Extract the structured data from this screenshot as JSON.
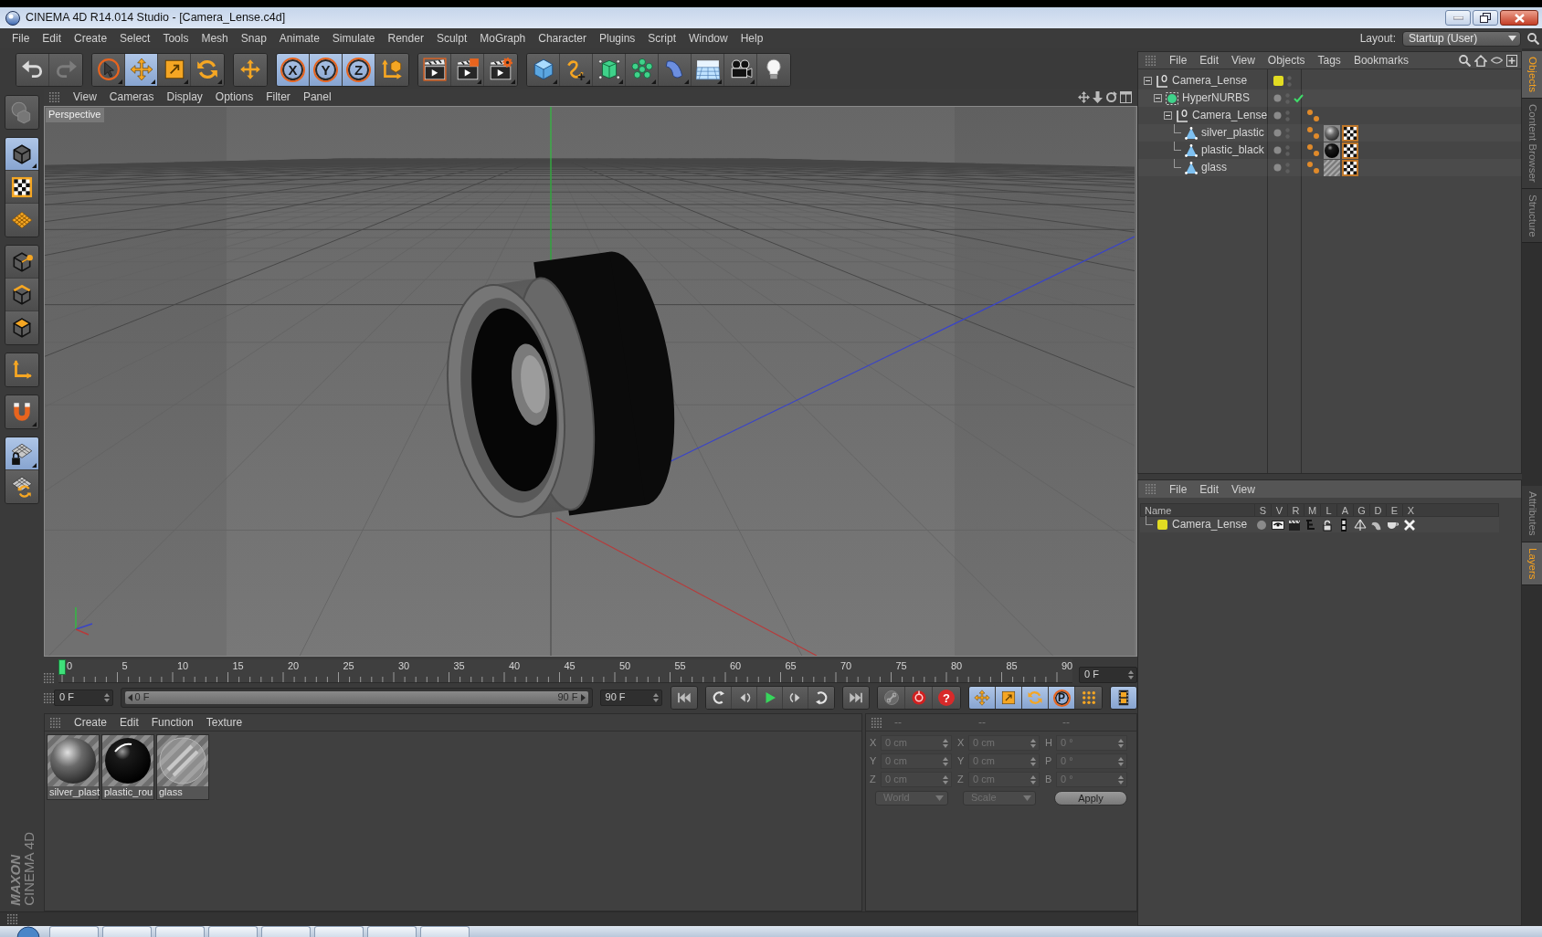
{
  "window": {
    "title": "CINEMA 4D R14.014 Studio - [Camera_Lense.c4d]"
  },
  "menu_bar": {
    "items": [
      "File",
      "Edit",
      "Create",
      "Select",
      "Tools",
      "Mesh",
      "Snap",
      "Animate",
      "Simulate",
      "Render",
      "Sculpt",
      "MoGraph",
      "Character",
      "Plugins",
      "Script",
      "Window",
      "Help"
    ],
    "layout_label": "Layout:",
    "layout_value": "Startup (User)"
  },
  "toolbar": {
    "groups": [
      [
        {
          "kind": "undo",
          "selected": false
        },
        {
          "kind": "redo",
          "selected": false
        }
      ],
      [
        {
          "kind": "select",
          "selected": false
        },
        {
          "kind": "move",
          "selected": true
        },
        {
          "kind": "scale",
          "selected": false
        },
        {
          "kind": "rotate",
          "selected": false
        }
      ],
      [
        {
          "kind": "last",
          "selected": false
        }
      ],
      [
        {
          "kind": "axis",
          "label": "X",
          "selected": true
        },
        {
          "kind": "axis",
          "label": "Y",
          "selected": true
        },
        {
          "kind": "axis",
          "label": "Z",
          "selected": true
        },
        {
          "kind": "coords",
          "selected": false
        }
      ],
      [
        {
          "kind": "renderview",
          "selected": false
        },
        {
          "kind": "renderpv",
          "selected": false
        },
        {
          "kind": "rendersettings",
          "selected": false
        }
      ],
      [
        {
          "kind": "cube",
          "selected": false
        },
        {
          "kind": "pen",
          "selected": false
        },
        {
          "kind": "subdivision",
          "selected": false
        },
        {
          "kind": "array",
          "selected": false
        },
        {
          "kind": "bend",
          "selected": false
        },
        {
          "kind": "floor",
          "selected": false
        },
        {
          "kind": "camera",
          "selected": false
        },
        {
          "kind": "light",
          "selected": false
        }
      ]
    ]
  },
  "left_toolbar": {
    "groups": [
      [
        {
          "kind": "modelview",
          "selected": false
        }
      ],
      [
        {
          "kind": "model",
          "selected": true
        },
        {
          "kind": "texture",
          "selected": false
        },
        {
          "kind": "workplane",
          "selected": false
        }
      ],
      [
        {
          "kind": "points",
          "selected": false
        },
        {
          "kind": "edges",
          "selected": false
        },
        {
          "kind": "polygons",
          "selected": false
        }
      ],
      [
        {
          "kind": "enableaxis",
          "selected": false
        }
      ],
      [
        {
          "kind": "snap",
          "selected": false
        }
      ],
      [
        {
          "kind": "gridlock",
          "selected": true
        },
        {
          "kind": "gridrotate",
          "selected": false
        }
      ]
    ],
    "logo": {
      "brand": "MAXON",
      "product": "CINEMA 4D"
    }
  },
  "viewport": {
    "menu": [
      "View",
      "Cameras",
      "Display",
      "Options",
      "Filter",
      "Panel"
    ],
    "camera": "Perspective"
  },
  "timeline": {
    "ruler_labels": [
      "0",
      "5",
      "10",
      "15",
      "20",
      "25",
      "30",
      "35",
      "40",
      "45",
      "50",
      "55",
      "60",
      "65",
      "70",
      "75",
      "80",
      "85",
      "90"
    ],
    "playhead": {
      "level": 0
    },
    "current_frame": "0 F",
    "start_field": "0 F",
    "range": {
      "start": "0 F",
      "end": "90 F",
      "level": 1
    },
    "end_field": "90 F"
  },
  "transport": {
    "groups": [
      [
        {
          "kind": "start",
          "selected": false
        }
      ],
      [
        {
          "kind": "prevkey",
          "selected": false
        },
        {
          "kind": "prevframe",
          "selected": false
        },
        {
          "kind": "play",
          "selected": false
        },
        {
          "kind": "nextframe",
          "selected": false
        },
        {
          "kind": "nextkey",
          "selected": false
        }
      ],
      [
        {
          "kind": "end",
          "selected": false
        }
      ],
      [
        {
          "kind": "autokey",
          "selected": false
        },
        {
          "kind": "record",
          "selected": false
        },
        {
          "kind": "help",
          "label": "?",
          "selected": false
        }
      ],
      [
        {
          "kind": "keymove",
          "selected": true
        },
        {
          "kind": "keyscale",
          "selected": true
        },
        {
          "kind": "keyrotate",
          "selected": true
        },
        {
          "kind": "keyparam",
          "label": "P",
          "selected": true
        },
        {
          "kind": "keypoints",
          "selected": false
        }
      ],
      [
        {
          "kind": "timeline",
          "selected": true
        }
      ]
    ]
  },
  "materials": {
    "menu": [
      "Create",
      "Edit",
      "Function",
      "Texture"
    ],
    "items": [
      {
        "name": "silver_plast",
        "kind": "silver"
      },
      {
        "name": "plastic_rou",
        "kind": "black"
      },
      {
        "name": "glass",
        "kind": "glass"
      }
    ]
  },
  "coordinates": {
    "disabled": true,
    "headers": [
      "--",
      "--",
      "--"
    ],
    "rows": [
      [
        {
          "label": "X",
          "value": "0 cm"
        },
        {
          "label": "X",
          "value": "0 cm"
        },
        {
          "label": "H",
          "value": "0 °"
        }
      ],
      [
        {
          "label": "Y",
          "value": "0 cm"
        },
        {
          "label": "Y",
          "value": "0 cm"
        },
        {
          "label": "P",
          "value": "0 °"
        }
      ],
      [
        {
          "label": "Z",
          "value": "0 cm"
        },
        {
          "label": "Z",
          "value": "0 cm"
        },
        {
          "label": "B",
          "value": "0 °"
        }
      ]
    ],
    "dropdowns": [
      "World",
      "Scale"
    ],
    "apply": "Apply"
  },
  "objects": {
    "menu": [
      "File",
      "Edit",
      "View",
      "Objects",
      "Tags",
      "Bookmarks"
    ],
    "tree": [
      {
        "name": "Camera_Lense",
        "kind": "null",
        "color": "#e2dc22",
        "children": [
          {
            "name": "HyperNURBS",
            "kind": "generator",
            "enabled": true,
            "children": [
              {
                "name": "Camera_Lense",
                "kind": "null",
                "tags": [
                  {
                    "kind": "phong"
                  }
                ],
                "children": [
                  {
                    "name": "silver_plastic",
                    "kind": "polygon",
                    "tags": [
                      {
                        "kind": "phong"
                      },
                      {
                        "kind": "silver"
                      },
                      {
                        "kind": "uvw"
                      }
                    ]
                  },
                  {
                    "name": "plastic_black",
                    "kind": "polygon",
                    "tags": [
                      {
                        "kind": "phong"
                      },
                      {
                        "kind": "black"
                      },
                      {
                        "kind": "uvw"
                      }
                    ]
                  },
                  {
                    "name": "glass",
                    "kind": "polygon",
                    "tags": [
                      {
                        "kind": "phong"
                      },
                      {
                        "kind": "glass"
                      },
                      {
                        "kind": "uvw"
                      }
                    ]
                  }
                ]
              }
            ]
          }
        ]
      }
    ]
  },
  "layers": {
    "menu": [
      "File",
      "Edit",
      "View"
    ],
    "columns": [
      "Name",
      "S",
      "V",
      "R",
      "M",
      "L",
      "A",
      "G",
      "D",
      "E",
      "X"
    ],
    "rows": [
      {
        "name": "Camera_Lense",
        "color": "#e2dc22"
      }
    ]
  },
  "side_tabs_top": [
    {
      "label": "Objects",
      "selected": true
    },
    {
      "label": "Content Browser",
      "selected": false
    },
    {
      "label": "Structure",
      "selected": false
    }
  ],
  "side_tabs_bottom": [
    {
      "label": "Attributes",
      "selected": false
    },
    {
      "label": "Layers",
      "selected": true
    }
  ]
}
